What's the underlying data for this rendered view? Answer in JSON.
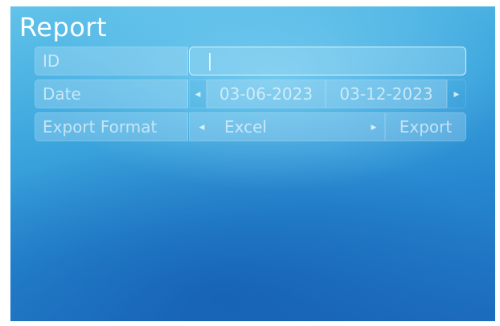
{
  "report": {
    "title": "Report",
    "id_row": {
      "label": "ID",
      "value": ""
    },
    "date_row": {
      "label": "Date",
      "start_date": "03-06-2023",
      "end_date": "03-12-2023",
      "prev_icon": "triangle-left-icon",
      "next_icon": "triangle-right-icon"
    },
    "export_row": {
      "label": "Export Format",
      "format_value": "Excel",
      "export_button": "Export",
      "prev_icon": "triangle-left-icon",
      "next_icon": "triangle-right-icon"
    }
  }
}
